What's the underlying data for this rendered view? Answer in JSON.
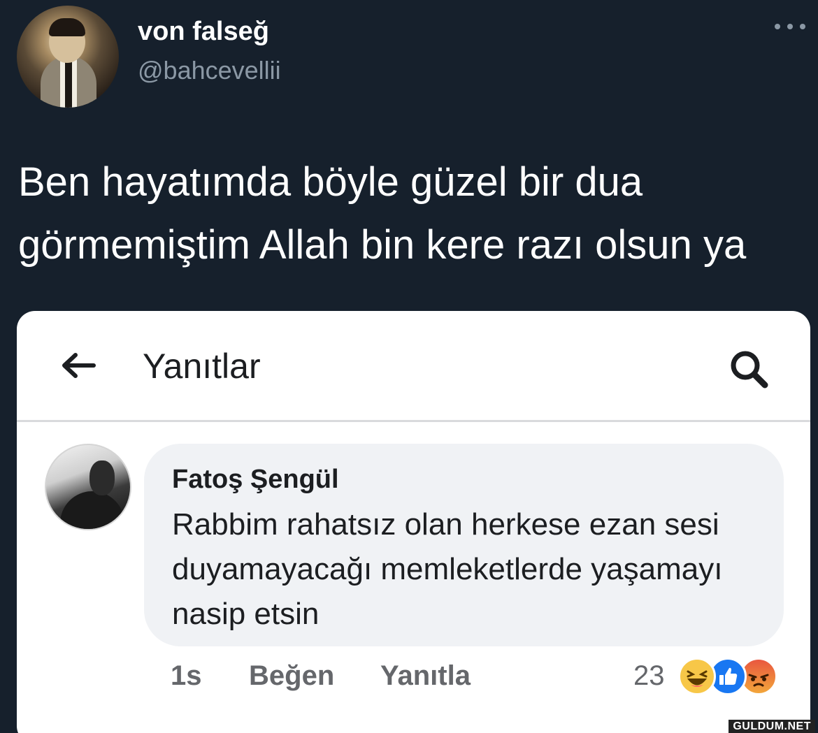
{
  "tweet": {
    "display_name": "von falseğ",
    "handle": "@bahcevellii",
    "text": "Ben hayatımda böyle güzel bir dua görmemiştim Allah bin kere razı olsun ya",
    "more_icon": "more-horizontal-icon"
  },
  "embed": {
    "header_title": "Yanıtlar",
    "back_icon": "arrow-left-icon",
    "search_icon": "search-icon",
    "comment": {
      "author": "Fatoş Şengül",
      "text": "Rabbim rahatsız olan herkese ezan sesi duyamayacağı memleketlerde yaşamayı nasip etsin",
      "time": "1s",
      "like_label": "Beğen",
      "reply_label": "Yanıtla",
      "reaction_count": "23",
      "reactions": [
        "haha",
        "like",
        "angry"
      ]
    }
  },
  "watermark": "GULDUM.NET",
  "colors": {
    "background": "#16202c",
    "handle": "#8b98a5",
    "card": "#ffffff",
    "bubble": "#f0f2f5",
    "meta": "#65676b",
    "like_blue": "#1877f2",
    "haha_yellow": "#f7c748",
    "angry_orange": "#e9573f"
  }
}
